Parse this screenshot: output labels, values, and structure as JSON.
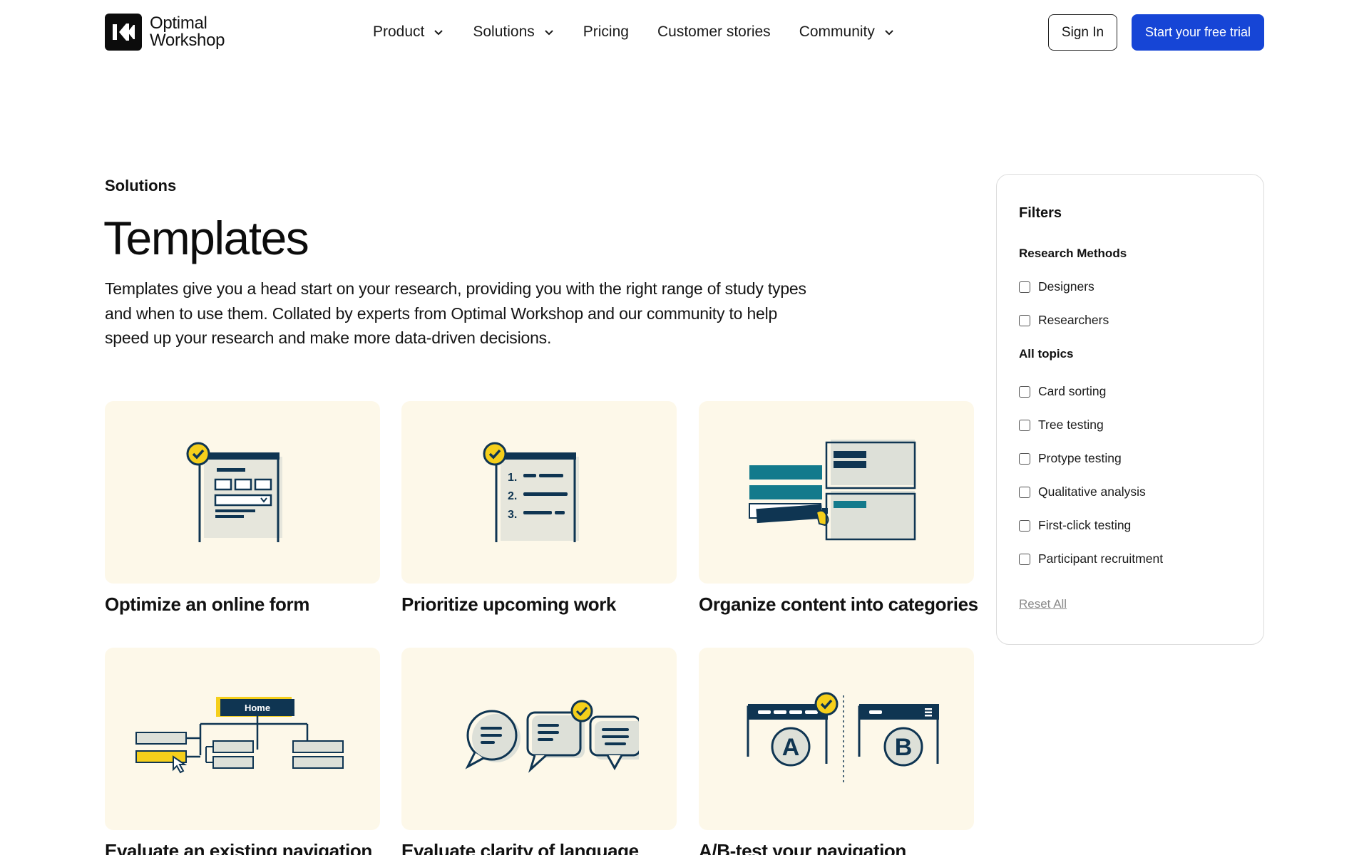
{
  "header": {
    "logo_line1": "Optimal",
    "logo_line2": "Workshop",
    "nav": [
      {
        "label": "Product",
        "has_dropdown": true
      },
      {
        "label": "Solutions",
        "has_dropdown": true
      },
      {
        "label": "Pricing",
        "has_dropdown": false
      },
      {
        "label": "Customer stories",
        "has_dropdown": false
      },
      {
        "label": "Community",
        "has_dropdown": true
      }
    ],
    "sign_in": "Sign In",
    "trial": "Start your free trial"
  },
  "intro": {
    "eyebrow": "Solutions",
    "title": "Templates",
    "description": "Templates give you a head start on your research, providing you with the right range of study types and when to use them. Collated by experts from Optimal Workshop and our community to help speed up your research and make more data-driven decisions."
  },
  "cards": [
    {
      "title": "Optimize an online form",
      "illustration": "form-icon"
    },
    {
      "title": "Prioritize upcoming work",
      "illustration": "numbered-list-icon"
    },
    {
      "title": "Organize content into categories",
      "illustration": "card-sort-icon"
    },
    {
      "title": "Evaluate an existing navigation",
      "illustration": "tree-navigation-icon",
      "home_label": "Home"
    },
    {
      "title": "Evaluate clarity of language",
      "illustration": "speech-bubbles-icon"
    },
    {
      "title": "A/B-test your navigation",
      "illustration": "ab-test-icon",
      "label_a": "A",
      "label_b": "B"
    }
  ],
  "filters": {
    "title": "Filters",
    "groups": [
      {
        "title": "Research Methods",
        "options": [
          "Designers",
          "Researchers"
        ]
      },
      {
        "title": "All topics",
        "options": [
          "Card sorting",
          "Tree testing",
          "Protype testing",
          "Qualitative analysis",
          "First-click testing",
          "Participant recruitment"
        ]
      }
    ],
    "reset": "Reset All"
  },
  "colors": {
    "brand_blue": "#1645d6",
    "navy": "#0f3552",
    "accent_yellow": "#f5cf1b",
    "card_bg": "#fdf8e9",
    "teal": "#137a8c"
  }
}
